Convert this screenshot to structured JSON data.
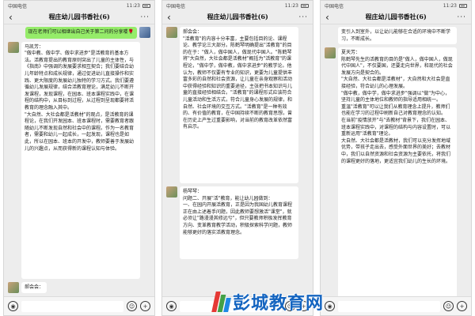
{
  "status": {
    "carrier": "中国电信",
    "time": "11:23"
  },
  "chat": {
    "title": "程庄幼儿园书香社(6)",
    "back": "‹",
    "more": "···"
  },
  "phones": [
    {
      "messages": [
        {
          "from": "me",
          "text": "现在老师们可以相继出自己关于第二问的分享喽🌹"
        },
        {
          "from": "other",
          "text": "马凯芳：\n\"做中教、做中学、做中求进步\"是活教育的基本方法。活教育提出的教育原则突出了儿童的主体性，与《指南》中强调的发展要求相互契合；我们要结合幼儿年龄特点和成长规律，通过促进幼儿直接操作和实践、更大限度的发展幼儿独特的学习方式。我们要遵循幼儿发展规律，结合活教育理论，满足幼儿不断开发课程，发现课程，在园本、班本课程实践中，在课程的结构中，从目标到过程，从过程到呈现都要将活教育的理念融入其中。\n\"大自然、大社会都是活教材\"的观点，是活教育的课程论，在我们开发园本、班本课程时，需要教育者跟随幼儿不断发现自然和社会中的课程。作为一名教育者，需要和幼儿一起成长，一起发现，课程也是如此，所以在园本、班本的开发中，教师要善于发展幼儿的兴趣点，从而获得新的课程认知与体验。"
        },
        {
          "from": "other",
          "text": "郝会会："
        }
      ]
    },
    {
      "messages": [
        {
          "from": "other",
          "text": "郝会会：\n\"活教育\"的内容十分丰富，主要包括目的论、课程论、教学论三大部分。陈鹤琴明确提出\"活教育\"的目的在于：\"做人，做中国人，做现代中国人。\"陈鹤琴将\"大自然，大社会都是活教材\"概括为\"活教育\"的课程论，\"做中学，做中教，做中求进步\"的教学论。他认为，教师不仅要有专业的知识，更要为儿童提供丰富多彩的自然和社会资源，让儿童在亲身观察和活动中获得经验和知识的重要途径，主张把书本知识与儿童的直接经验相结合。\"活教育\"的课程形式应该符合儿童活动和生活方式，符合儿童身心发展的规律，和自然、社会环境的交互方式。\"活教育\"是一种有效的、有价值的教育，在中国持续不断的教育思想，曾在历史上产生过重要影响，对当前的教育改革依然富有启示。"
        },
        {
          "from": "other",
          "text": "杨琴琴：\n问题二、开展\"活\"教育，能让幼儿园做到：\n一、在园内开展活教育，正是因为我国幼儿教育课程正在由上述着手问题，因此教师要想激活\"课堂\"，就必须让\"路漫漫其修远兮\"，但只要教师积极发挥教育方向、变革教育教学活动，积极探索科学问题，教师能够更好的落实活教育理念。"
        }
      ]
    },
    {
      "messages": [
        {
          "from": "other",
          "text": "变引入到室外，以让幼儿能够在合适的环境中不断学习，不断成长。"
        },
        {
          "from": "other",
          "text": "夏天芳：\n陈鹤琴先生的活教育的目的是\"做人，做中国人，做现代中国人\"，不仅要国，还要走向世界，和现代的社会发展方向是契合的。\n\"大自然、大社会都是活教材\"，大自然和大社会是直接经验，符合幼儿的心理发展。\n\"做中教，做中学，做中求进步\"强调以\"做\"为中心，坚持儿童的主体地位和教师的指导适用相统一。\n重温\"活教育\"可以让我们从教育理念上提升，教师们也能在学习的过程中刷新自己对教育理念的认知。\n在当前\"疫情放开\"与\"去教材\"背景下，我们在园本、班本课程实践中，对课程的结构与内容设置时，可以重新运用\"活教育\"理论。\n大自然、大社会都是活教材，我们可以充分发挥地域优势，带孩子走出去，感受外面世界的美好；去教材中，我们以自然资源和社会资源为主要依托，将我们的课程更好的落地，更适宜我们幼儿的生长的环境。"
        }
      ]
    }
  ],
  "watermark": {
    "text": "彭城教育网"
  }
}
